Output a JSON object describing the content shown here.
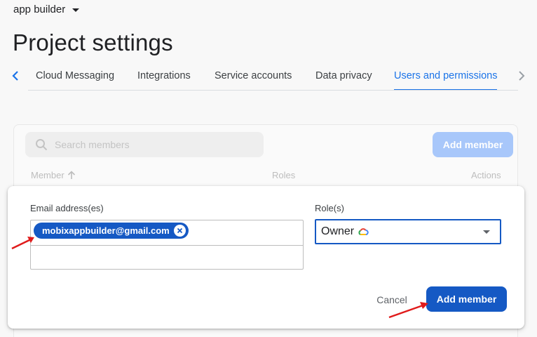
{
  "header": {
    "project_name": "app builder",
    "page_title": "Project settings"
  },
  "tabs": [
    {
      "label": "Cloud Messaging",
      "active": false
    },
    {
      "label": "Integrations",
      "active": false
    },
    {
      "label": "Service accounts",
      "active": false
    },
    {
      "label": "Data privacy",
      "active": false
    },
    {
      "label": "Users and permissions",
      "active": true
    }
  ],
  "members_panel": {
    "search_placeholder": "Search members",
    "add_member_label": "Add member",
    "columns": {
      "member": "Member",
      "roles": "Roles",
      "actions": "Actions"
    }
  },
  "dialog": {
    "email_label": "Email address(es)",
    "email_chip": "mobixappbuilder@gmail.com",
    "role_label": "Role(s)",
    "role_value": "Owner",
    "role_icon": "google-cloud-icon",
    "cancel_label": "Cancel",
    "add_member_label": "Add member"
  },
  "colors": {
    "accent": "#1a73e8",
    "primary_button": "#1559c4",
    "disabled_button": "#a8c7fa",
    "annotation_arrow": "#e01b1b"
  }
}
